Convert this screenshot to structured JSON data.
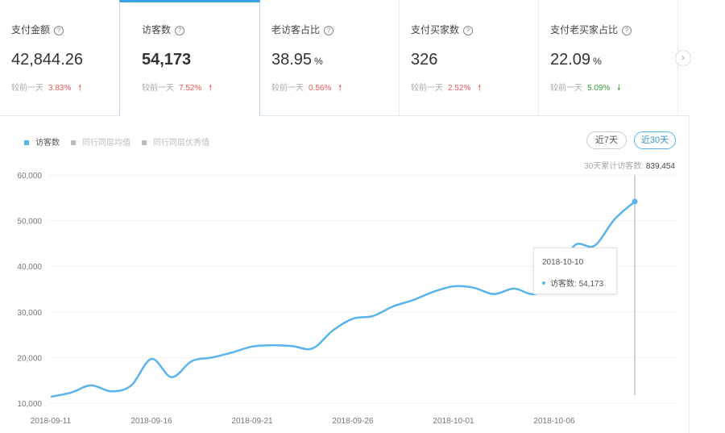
{
  "cards": [
    {
      "title": "支付金额",
      "value": "42,844.26",
      "unit": "",
      "compare_label": "较前一天",
      "change": "3.83%",
      "direction": "up"
    },
    {
      "title": "访客数",
      "value": "54,173",
      "unit": "",
      "compare_label": "较前一天",
      "change": "7.52%",
      "direction": "up"
    },
    {
      "title": "老访客占比",
      "value": "38.95",
      "unit": "%",
      "compare_label": "较前一天",
      "change": "0.56%",
      "direction": "up"
    },
    {
      "title": "支付买家数",
      "value": "326",
      "unit": "",
      "compare_label": "较前一天",
      "change": "2.52%",
      "direction": "up"
    },
    {
      "title": "支付老买家占比",
      "value": "22.09",
      "unit": "%",
      "compare_label": "较前一天",
      "change": "5.09%",
      "direction": "down"
    }
  ],
  "icons": {
    "help": "?",
    "up": "🠕",
    "down": "🠗",
    "next": "›"
  },
  "legend": [
    "访客数",
    "同行同层均值",
    "同行同层优秀值"
  ],
  "range_buttons": {
    "d7": "近7天",
    "d30": "近30天"
  },
  "total": {
    "label": "30天累计访客数:",
    "value": "839,454"
  },
  "tooltip": {
    "date": "2018-10-10",
    "label": "访客数:",
    "value": "54,173"
  },
  "colors": {
    "line": "#5ab4ec",
    "up": "#e85b5b",
    "down": "#3c9a3c"
  },
  "chart_data": {
    "type": "line",
    "xlabel": "",
    "ylabel": "",
    "ylim": [
      10000,
      60000
    ],
    "yticks": [
      "10,000",
      "20,000",
      "30,000",
      "40,000",
      "50,000",
      "60,000"
    ],
    "xticks": [
      "2018-09-11",
      "2018-09-16",
      "2018-09-21",
      "2018-09-26",
      "2018-10-01",
      "2018-10-06"
    ],
    "x": [
      "09-11",
      "09-12",
      "09-13",
      "09-14",
      "09-15",
      "09-16",
      "09-17",
      "09-18",
      "09-19",
      "09-20",
      "09-21",
      "09-22",
      "09-23",
      "09-24",
      "09-25",
      "09-26",
      "09-27",
      "09-28",
      "09-29",
      "09-30",
      "10-01",
      "10-02",
      "10-03",
      "10-04",
      "10-05",
      "10-06",
      "10-07",
      "10-08",
      "10-09",
      "10-10"
    ],
    "series": [
      {
        "name": "访客数",
        "values": [
          11400,
          12300,
          13900,
          12600,
          13900,
          19700,
          15700,
          19200,
          20000,
          21100,
          22400,
          22700,
          22500,
          22000,
          25900,
          28500,
          29100,
          31200,
          32600,
          34400,
          35600,
          35300,
          33900,
          35100,
          33900,
          36500,
          44500,
          44500,
          50300,
          54173
        ]
      }
    ]
  }
}
